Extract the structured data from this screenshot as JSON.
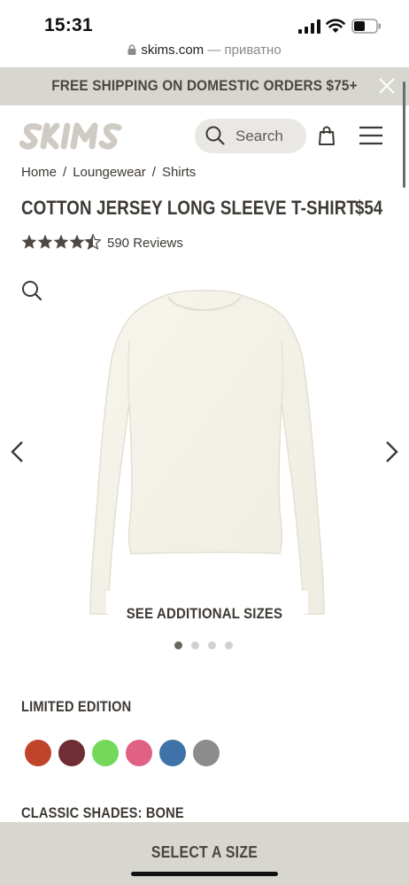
{
  "status_bar": {
    "time": "15:31",
    "icons": [
      "cellular-signal-icon",
      "wifi-icon",
      "battery-icon"
    ]
  },
  "browser": {
    "domain": "skims.com",
    "separator": " — ",
    "privacy": "приватно"
  },
  "promo": {
    "text": "FREE SHIPPING ON DOMESTIC ORDERS $75+",
    "close_icon": "close-icon",
    "background": "#d8d7cf"
  },
  "header": {
    "logo": "SKIMS",
    "search_placeholder": "Search",
    "icons": [
      "search-icon",
      "bag-icon",
      "menu-icon"
    ]
  },
  "breadcrumb": [
    {
      "label": "Home"
    },
    {
      "label": "Loungewear"
    },
    {
      "label": "Shirts"
    }
  ],
  "breadcrumb_separator": "/",
  "product": {
    "title": "COTTON JERSEY LONG SLEEVE T-SHIRT",
    "price": "$54",
    "rating": 4.5,
    "rating_max": 5,
    "reviews": "590 Reviews",
    "additional_sizes": "SEE ADDITIONAL SIZES",
    "image_count": 4,
    "active_image": 1
  },
  "colors": {
    "limited_label": "LIMITED EDITION",
    "swatches": [
      {
        "name": "red",
        "hex": "#c0432b"
      },
      {
        "name": "burgundy",
        "hex": "#6e2e33"
      },
      {
        "name": "green",
        "hex": "#74d95a"
      },
      {
        "name": "pink",
        "hex": "#e06184"
      },
      {
        "name": "blue",
        "hex": "#3f72a8"
      },
      {
        "name": "gray",
        "hex": "#8c8c8c"
      }
    ],
    "classic_label": "CLASSIC SHADES: BONE"
  },
  "cta": {
    "select_size": "SELECT A SIZE"
  },
  "theme": {
    "text": "#3d3935",
    "banner_bg": "#d8d7cf",
    "dot_active": "#6b6560",
    "dot_inactive": "#d1d1d1"
  }
}
